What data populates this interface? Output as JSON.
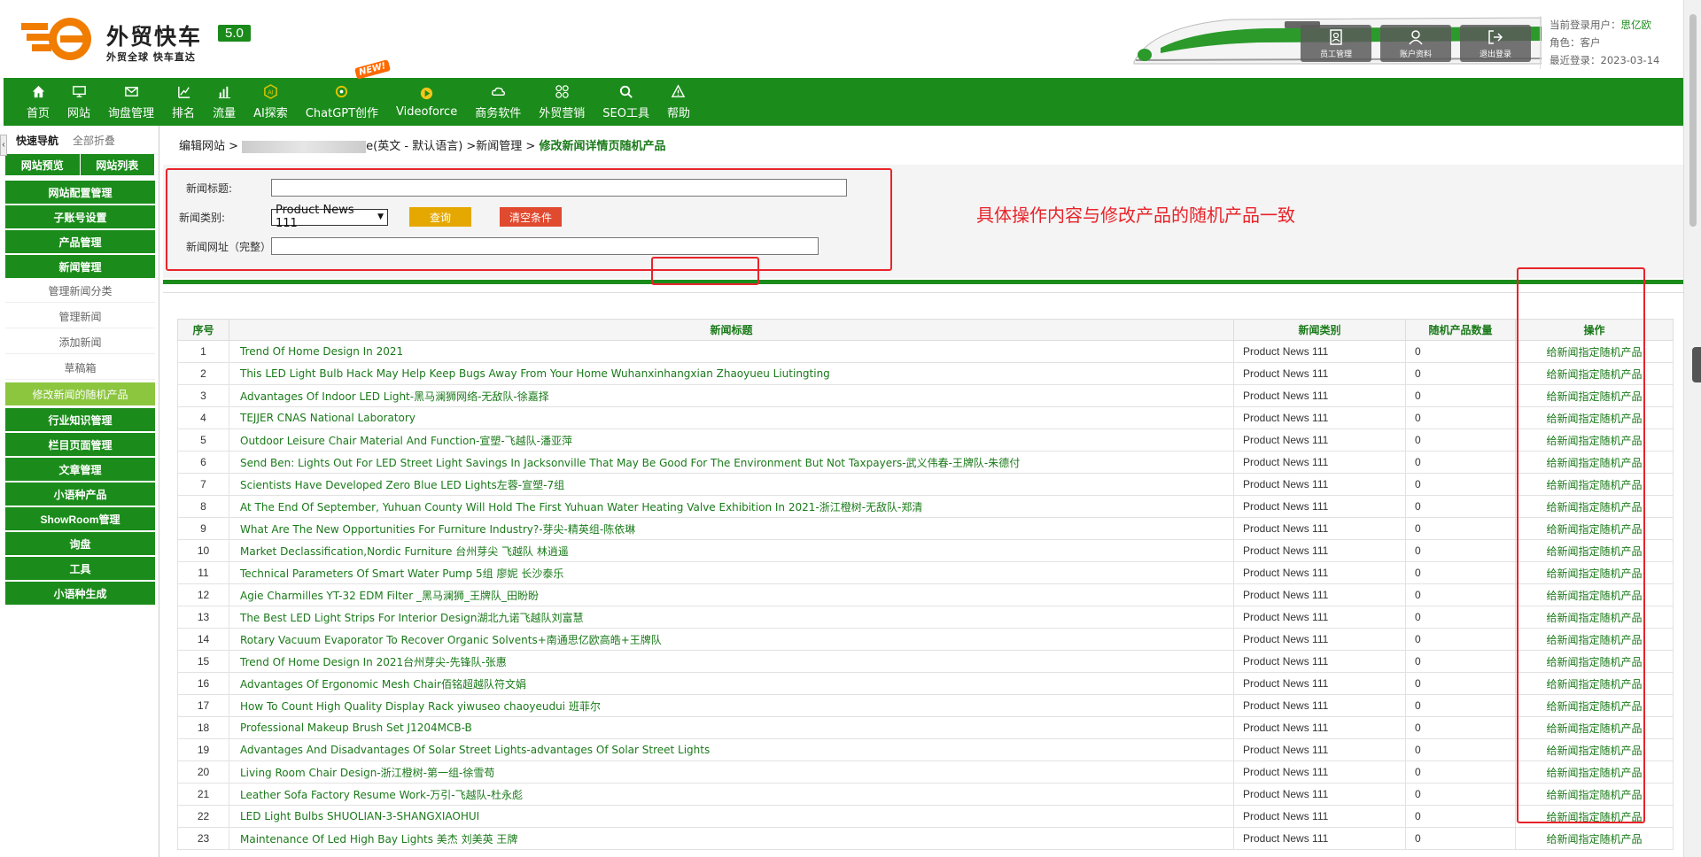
{
  "header": {
    "logo_title": "外贸快车",
    "logo_sub": "外贸全球 快车直达",
    "version": "5.0",
    "buttons": [
      {
        "label": "员工管理",
        "icon": "staff-icon"
      },
      {
        "label": "账户资料",
        "icon": "account-icon"
      },
      {
        "label": "退出登录",
        "icon": "logout-icon"
      }
    ],
    "user_label": "当前登录用户：",
    "user_name": "思亿欧",
    "role": "角色：客户",
    "last_login": "最近登录：2023-03-14"
  },
  "nav": {
    "items": [
      {
        "label": "首页",
        "icon": "home-icon"
      },
      {
        "label": "网站",
        "icon": "monitor-icon"
      },
      {
        "label": "询盘管理",
        "icon": "mail-icon"
      },
      {
        "label": "排名",
        "icon": "ranking-icon"
      },
      {
        "label": "流量",
        "icon": "bar-chart-icon"
      },
      {
        "label": "AI探索",
        "icon": "ai-icon"
      },
      {
        "label": "ChatGPT创作",
        "icon": "chatgpt-icon",
        "badge": "NEW!"
      },
      {
        "label": "Videoforce",
        "icon": "video-icon"
      },
      {
        "label": "商务软件",
        "icon": "cloud-icon"
      },
      {
        "label": "外贸营销",
        "icon": "grid-icon"
      },
      {
        "label": "SEO工具",
        "icon": "search-icon"
      },
      {
        "label": "帮助",
        "icon": "warning-icon"
      }
    ]
  },
  "sidebar": {
    "head_title": "快速导航",
    "head_collapse": "全部折叠",
    "toggle": "‹",
    "preview": "网站预览",
    "site_list": "网站列表",
    "items": [
      {
        "label": "网站配置管理",
        "type": "group"
      },
      {
        "label": "子账号设置",
        "type": "group"
      },
      {
        "label": "产品管理",
        "type": "group"
      },
      {
        "label": "新闻管理",
        "type": "group"
      },
      {
        "label": "管理新闻分类",
        "type": "sub"
      },
      {
        "label": "管理新闻",
        "type": "sub"
      },
      {
        "label": "添加新闻",
        "type": "sub"
      },
      {
        "label": "草稿箱",
        "type": "sub"
      },
      {
        "label": "修改新闻的随机产品",
        "type": "active"
      },
      {
        "label": "行业知识管理",
        "type": "group"
      },
      {
        "label": "栏目页面管理",
        "type": "group"
      },
      {
        "label": "文章管理",
        "type": "group"
      },
      {
        "label": "小语种产品",
        "type": "group"
      },
      {
        "label": "ShowRoom管理",
        "type": "group"
      },
      {
        "label": "询盘",
        "type": "group"
      },
      {
        "label": "工具",
        "type": "group"
      },
      {
        "label": "小语种生成",
        "type": "group"
      }
    ]
  },
  "breadcrumb": {
    "prefix": "编辑网站 > ",
    "site_suffix": "e(英文 - 默认语言) >新闻管理 > ",
    "current": "修改新闻详情页随机产品"
  },
  "filter": {
    "title_label": "新闻标题:",
    "title_value": "",
    "category_label": "新闻类别:",
    "category_value": "Product News 111",
    "query_button": "查询",
    "clear_button": "清空条件",
    "url_label": "新闻网址（完整）",
    "url_value": ""
  },
  "annotation": "具体操作内容与修改产品的随机产品一致",
  "colors": {
    "brand_green": "#1b8c1b",
    "annotation_red": "#e8242a",
    "active_green": "#8cc63f"
  },
  "table": {
    "headers": [
      "序号",
      "新闻标题",
      "新闻类别",
      "随机产品数量",
      "操作"
    ],
    "rows": [
      {
        "no": "1",
        "title": "Trend Of Home Design In 2021",
        "category": "Product News 111",
        "count": "0",
        "op": "给新闻指定随机产品"
      },
      {
        "no": "2",
        "title": "This LED Light Bulb Hack May Help Keep Bugs Away From Your Home Wuhanxinhangxian Zhaoyueu Liutingting",
        "category": "Product News 111",
        "count": "0",
        "op": "给新闻指定随机产品"
      },
      {
        "no": "3",
        "title": "Advantages Of Indoor LED Light-黑马澜狮网络-无敌队-徐嘉择",
        "category": "Product News 111",
        "count": "0",
        "op": "给新闻指定随机产品"
      },
      {
        "no": "4",
        "title": "TEJJER CNAS National Laboratory",
        "category": "Product News 111",
        "count": "0",
        "op": "给新闻指定随机产品"
      },
      {
        "no": "5",
        "title": "Outdoor Leisure Chair Material And Function-宣塑-飞越队-潘亚萍",
        "category": "Product News 111",
        "count": "0",
        "op": "给新闻指定随机产品"
      },
      {
        "no": "6",
        "title": "Send Ben: Lights Out For LED Street Light Savings In Jacksonville That May Be Good For The Environment But Not Taxpayers-武义伟春-王牌队-朱德付",
        "category": "Product News 111",
        "count": "0",
        "op": "给新闻指定随机产品"
      },
      {
        "no": "7",
        "title": "Scientists Have Developed Zero Blue LED Lights左蓉-宣塑-7组",
        "category": "Product News 111",
        "count": "0",
        "op": "给新闻指定随机产品"
      },
      {
        "no": "8",
        "title": "At The End Of September, Yuhuan County Will Hold The First Yuhuan Water Heating Valve Exhibition In 2021-浙江橙树-无敌队-郑清",
        "category": "Product News 111",
        "count": "0",
        "op": "给新闻指定随机产品"
      },
      {
        "no": "9",
        "title": "What Are The New Opportunities For Furniture Industry?-芽尖-精英组-陈依琳",
        "category": "Product News 111",
        "count": "0",
        "op": "给新闻指定随机产品"
      },
      {
        "no": "10",
        "title": "Market Declassification,Nordic Furniture 台州芽尖 飞越队 林逍遥",
        "category": "Product News 111",
        "count": "0",
        "op": "给新闻指定随机产品"
      },
      {
        "no": "11",
        "title": "Technical Parameters Of Smart Water Pump 5组 廖妮 长沙泰乐",
        "category": "Product News 111",
        "count": "0",
        "op": "给新闻指定随机产品"
      },
      {
        "no": "12",
        "title": "Agie Charmilles YT-32 EDM Filter _黑马澜狮_王牌队_田盼盼",
        "category": "Product News 111",
        "count": "0",
        "op": "给新闻指定随机产品"
      },
      {
        "no": "13",
        "title": "The Best LED Light Strips For Interior Design湖北九诺飞越队刘富慧",
        "category": "Product News 111",
        "count": "0",
        "op": "给新闻指定随机产品"
      },
      {
        "no": "14",
        "title": "Rotary Vacuum Evaporator To Recover Organic Solvents+南通思亿欧高皓+王牌队",
        "category": "Product News 111",
        "count": "0",
        "op": "给新闻指定随机产品"
      },
      {
        "no": "15",
        "title": "Trend Of Home Design In 2021台州芽尖-先锋队-张惠",
        "category": "Product News 111",
        "count": "0",
        "op": "给新闻指定随机产品"
      },
      {
        "no": "16",
        "title": "Advantages Of Ergonomic Mesh Chair佰铭超越队符文娟",
        "category": "Product News 111",
        "count": "0",
        "op": "给新闻指定随机产品"
      },
      {
        "no": "17",
        "title": "How To Count High Quality Display Rack yiwuseo chaoyeudui 班菲尔",
        "category": "Product News 111",
        "count": "0",
        "op": "给新闻指定随机产品"
      },
      {
        "no": "18",
        "title": "Professional Makeup Brush Set J1204MCB-B",
        "category": "Product News 111",
        "count": "0",
        "op": "给新闻指定随机产品"
      },
      {
        "no": "19",
        "title": "Advantages And Disadvantages Of Solar Street Lights-advantages Of Solar Street Lights",
        "category": "Product News 111",
        "count": "0",
        "op": "给新闻指定随机产品"
      },
      {
        "no": "20",
        "title": "Living Room Chair Design-浙江橙树-第一组-徐雪苟",
        "category": "Product News 111",
        "count": "0",
        "op": "给新闻指定随机产品"
      },
      {
        "no": "21",
        "title": "Leather Sofa Factory Resume Work-万引-飞越队-杜永彪",
        "category": "Product News 111",
        "count": "0",
        "op": "给新闻指定随机产品"
      },
      {
        "no": "22",
        "title": "LED Light Bulbs SHUOLIAN-3-SHANGXIAOHUI",
        "category": "Product News 111",
        "count": "0",
        "op": "给新闻指定随机产品"
      },
      {
        "no": "23",
        "title": "Maintenance Of Led High Bay Lights 美杰 刘美英 王牌",
        "category": "Product News 111",
        "count": "0",
        "op": "给新闻指定随机产品"
      }
    ]
  }
}
